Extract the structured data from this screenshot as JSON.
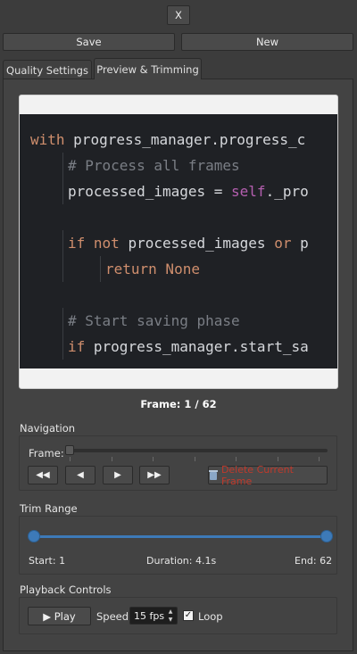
{
  "toolbar": {
    "close_label": "X",
    "save_label": "Save",
    "new_label": "New"
  },
  "tabs": [
    {
      "label": "Quality Settings",
      "active": false
    },
    {
      "label": "Preview & Trimming",
      "active": true
    }
  ],
  "preview": {
    "code_lines": [
      {
        "indent": 0,
        "tokens": [
          {
            "t": "with ",
            "c": "kw"
          },
          {
            "t": "progress_manager.progress_c",
            "c": ""
          }
        ]
      },
      {
        "indent": 1,
        "tokens": [
          {
            "t": "# Process all frames",
            "c": "cm"
          }
        ]
      },
      {
        "indent": 1,
        "tokens": [
          {
            "t": "processed_images = ",
            "c": ""
          },
          {
            "t": "self",
            "c": "sf"
          },
          {
            "t": "._pro",
            "c": ""
          }
        ]
      },
      {
        "indent": 0,
        "tokens": []
      },
      {
        "indent": 1,
        "tokens": [
          {
            "t": "if not ",
            "c": "kw"
          },
          {
            "t": "processed_images ",
            "c": ""
          },
          {
            "t": "or ",
            "c": "kw"
          },
          {
            "t": "p",
            "c": ""
          }
        ]
      },
      {
        "indent": 2,
        "tokens": [
          {
            "t": "return None",
            "c": "kw"
          }
        ]
      },
      {
        "indent": 0,
        "tokens": []
      },
      {
        "indent": 1,
        "tokens": [
          {
            "t": "# Start saving phase",
            "c": "cm"
          }
        ]
      },
      {
        "indent": 1,
        "tokens": [
          {
            "t": "if ",
            "c": "kw"
          },
          {
            "t": "progress_manager.start_sa",
            "c": ""
          }
        ]
      }
    ]
  },
  "frame_counter": "Frame: 1 / 62",
  "navigation": {
    "title": "Navigation",
    "frame_label": "Frame:",
    "frame_position": 0,
    "first_label": "◀◀",
    "prev_label": "◀",
    "next_label": "▶",
    "last_label": "▶▶",
    "delete_label": "Delete Current Frame"
  },
  "trim": {
    "title": "Trim Range",
    "start": "Start: 1",
    "duration": "Duration: 4.1s",
    "end": "End: 62",
    "start_fraction": 0.0,
    "end_fraction": 1.0
  },
  "playback": {
    "title": "Playback Controls",
    "play_label": "▶ Play",
    "speed_label": "Speed",
    "fps_value": "15 fps",
    "loop_checked": true,
    "loop_label": "Loop"
  },
  "colors": {
    "accent": "#3d7ab8",
    "delete": "#c0392b"
  }
}
